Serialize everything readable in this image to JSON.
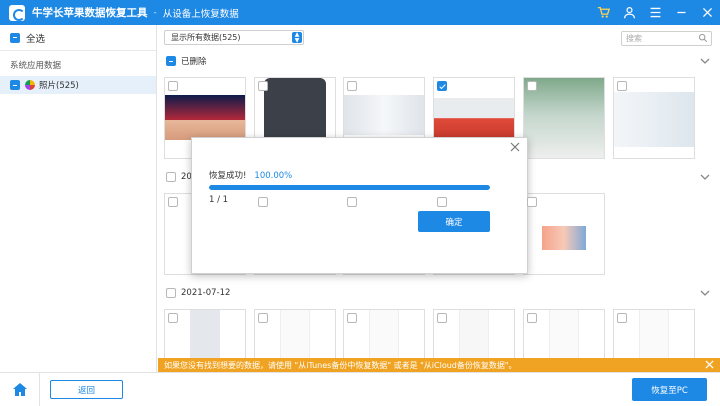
{
  "titlebar": {
    "app_name": "牛学长苹果数据恢复工具",
    "separator": "-",
    "subtitle": "从设备上恢复数据",
    "icons": [
      "cart-icon",
      "user-icon",
      "menu-icon",
      "minimize-icon",
      "close-icon"
    ]
  },
  "sidebar": {
    "select_all_label": "全选",
    "section_title": "系统应用数据",
    "items": [
      {
        "label": "照片(525)",
        "icon": "photos-icon",
        "state": "partial"
      }
    ]
  },
  "toolbar": {
    "filter_value": "显示所有数据(525)",
    "search_placeholder": "搜索"
  },
  "groups": [
    {
      "label": "已删除",
      "state": "partial"
    },
    {
      "label": "2021-07-15"
    },
    {
      "label": "2021-07-12"
    }
  ],
  "dialog": {
    "status_text": "恢复成功!",
    "percent_text": "100.00%",
    "progress": 1.0,
    "count_text": "1 / 1",
    "ok_label": "确定"
  },
  "warning": {
    "text": "如果您没有找到想要的数据，请使用 \"从iTunes备份中恢复数据\" 或者是 \"从iCloud备份恢复数据\"。"
  },
  "bottombar": {
    "back_label": "返回",
    "recover_label": "恢复至PC"
  },
  "colors": {
    "accent": "#1e88e5",
    "warning": "#f0a322"
  }
}
